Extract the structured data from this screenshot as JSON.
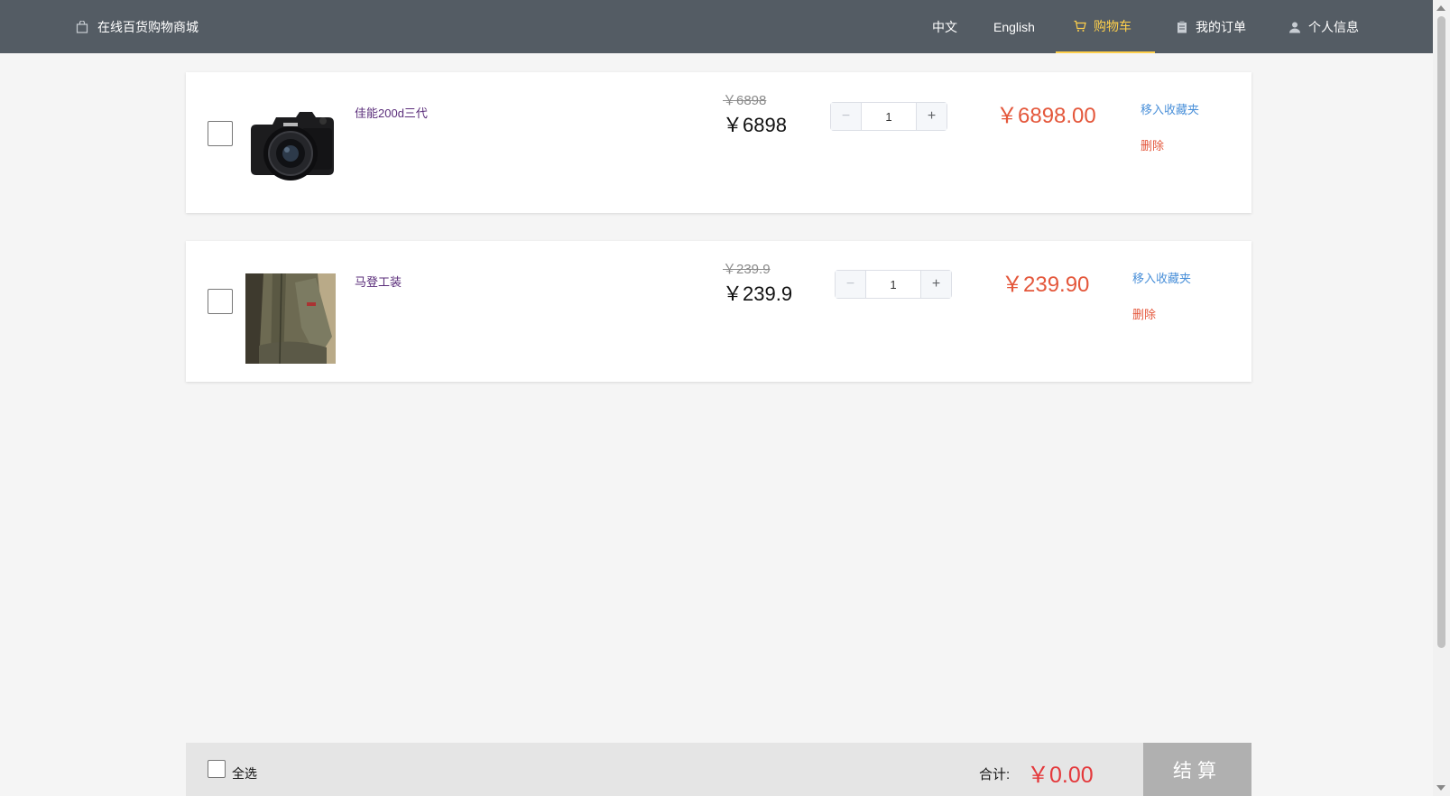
{
  "header": {
    "brand": "在线百货购物商城",
    "nav": {
      "chinese": "中文",
      "english": "English",
      "cart": "购物车",
      "orders": "我的订单",
      "profile": "个人信息"
    }
  },
  "cart": {
    "items": [
      {
        "name": "佳能200d三代",
        "original_price": "￥6898",
        "price": "￥6898",
        "quantity": "1",
        "subtotal": "￥6898.00",
        "favorite_label": "移入收藏夹",
        "delete_label": "删除"
      },
      {
        "name": "马登工装",
        "original_price": "￥239.9",
        "price": "￥239.9",
        "quantity": "1",
        "subtotal": "￥239.90",
        "favorite_label": "移入收藏夹",
        "delete_label": "删除"
      }
    ]
  },
  "footer": {
    "select_all": "全选",
    "total_label": "合计:",
    "total_value": "￥0.00",
    "checkout": "结算"
  },
  "colors": {
    "nav_bg": "#545c64",
    "nav_active": "#ffd04b",
    "price_red": "#e4573b",
    "link_blue": "#4a90d9"
  }
}
